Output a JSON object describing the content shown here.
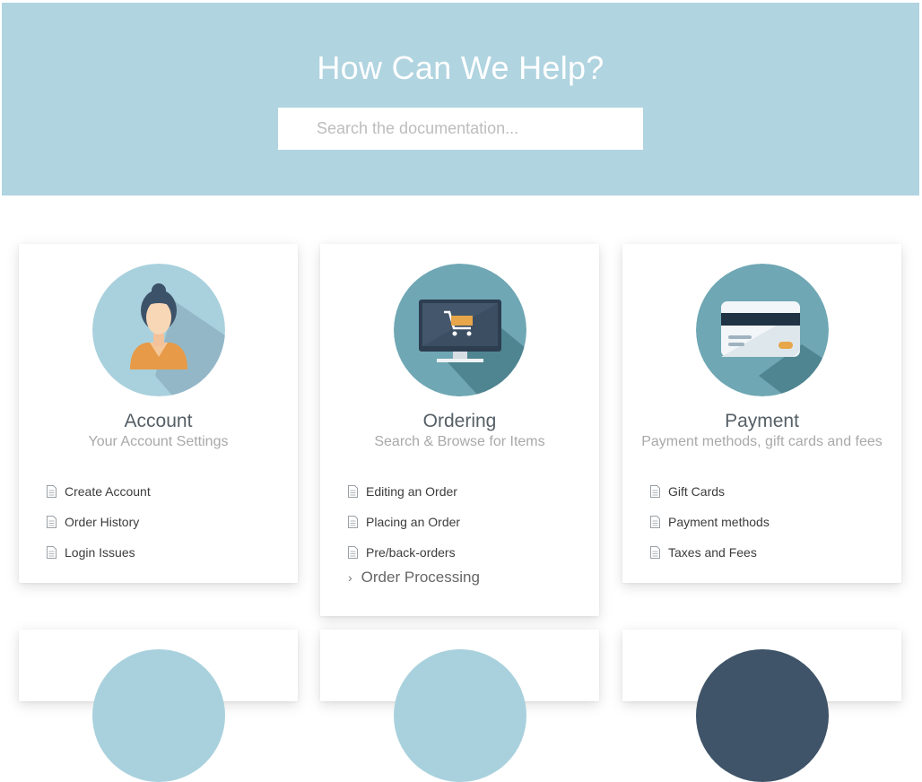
{
  "hero": {
    "title": "How Can We Help?",
    "search_placeholder": "Search the documentation..."
  },
  "cards": [
    {
      "title": "Account",
      "subtitle": "Your Account Settings",
      "icon": "user-avatar-icon",
      "links": [
        "Create Account",
        "Order History",
        "Login Issues"
      ]
    },
    {
      "title": "Ordering",
      "subtitle": "Search & Browse for Items",
      "icon": "monitor-cart-icon",
      "links": [
        "Editing an Order",
        "Placing an Order",
        "Pre/back-orders"
      ],
      "more": "Order Processing"
    },
    {
      "title": "Payment",
      "subtitle": "Payment methods, gift cards and fees",
      "icon": "credit-card-icon",
      "links": [
        "Gift Cards",
        "Payment methods",
        "Taxes and Fees"
      ]
    }
  ],
  "colors": {
    "hero_bg": "#b0d4e0",
    "circle_light": "#a9d1dd",
    "circle_teal": "#6fa7b4",
    "circle_dark": "#3f5468"
  }
}
